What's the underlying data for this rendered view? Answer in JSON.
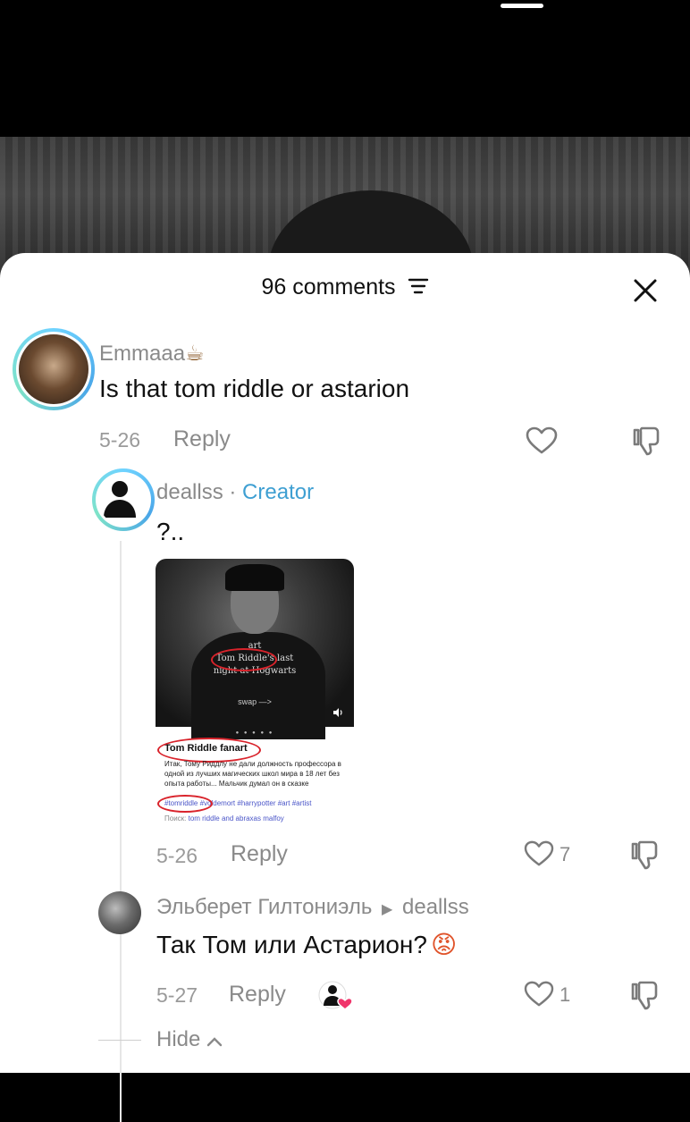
{
  "sheet": {
    "comment_count_label": "96 comments"
  },
  "comments": [
    {
      "username": "Emmaaa",
      "emoji": "☕",
      "text": "Is that tom riddle or astarion",
      "date": "5-26",
      "reply_label": "Reply"
    },
    {
      "username": "deallss",
      "separator": " · ",
      "badge": "Creator",
      "text": "?..",
      "date": "5-26",
      "reply_label": "Reply",
      "like_count": "7",
      "preview": {
        "caption_line1": "art",
        "caption_line2": "Tom Riddle's last",
        "caption_line3": "night at Hogwarts",
        "swap": "swap —>",
        "title": "Tom Riddle fanart",
        "description": "Итак, Тому Риддлу не дали должность профессора в одной из лучших магических школ мира в 18 лет без опыта работы... Мальчик думал он в сказке",
        "tags": "#tomriddle #voldemort #harrypotter #art #artist",
        "search_prefix": "Поиск: ",
        "search_query": "tom riddle and abraxas malfoy"
      }
    },
    {
      "username": "Эльберет Гилтониэль",
      "reply_to": "deallss",
      "text": "Так Том или Астарион?",
      "emoji": "😡",
      "date": "5-27",
      "reply_label": "Reply",
      "like_count": "1"
    }
  ],
  "hide_label": "Hide"
}
